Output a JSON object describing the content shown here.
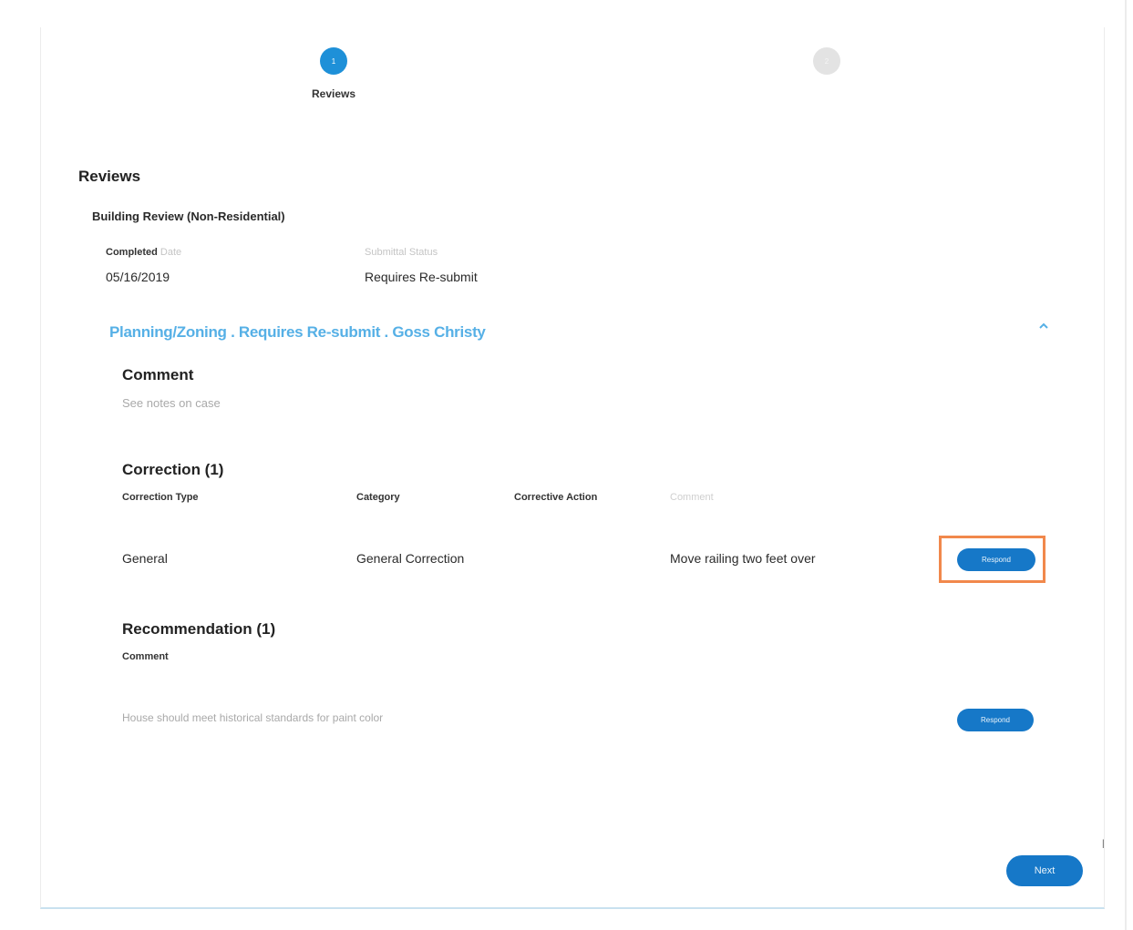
{
  "stepper": {
    "steps": [
      {
        "number": "1",
        "label": "Reviews",
        "active": true
      },
      {
        "number": "2",
        "label": "",
        "active": false
      }
    ]
  },
  "reviews": {
    "title": "Reviews",
    "review_name": "Building Review (Non-Residential)",
    "completed_label": "Completed",
    "completed_label_suffix": "Date",
    "completed_value": "05/16/2019",
    "status_label": "Submittal Status",
    "status_value": "Requires Re-submit"
  },
  "discipline": {
    "heading": "Planning/Zoning . Requires Re-submit . Goss Christy",
    "collapse_icon": "chevron-up-icon"
  },
  "comment": {
    "title": "Comment",
    "text": "See notes on case"
  },
  "corrections": {
    "title": "Correction (1)",
    "columns": [
      "Correction Type",
      "Category",
      "Corrective Action",
      "Comment"
    ],
    "rows": [
      {
        "type": "General",
        "category": "General Correction",
        "action": "",
        "comment": "Move railing two feet over",
        "button": "Respond"
      }
    ]
  },
  "recommendations": {
    "title": "Recommendation (1)",
    "column": "Comment",
    "rows": [
      {
        "comment": "House should meet historical standards for paint color",
        "button": "Respond"
      }
    ]
  },
  "footer": {
    "next_label": "Next"
  },
  "colors": {
    "accent": "#1678c8",
    "link": "#56b0e6",
    "highlight": "#f1884c"
  }
}
